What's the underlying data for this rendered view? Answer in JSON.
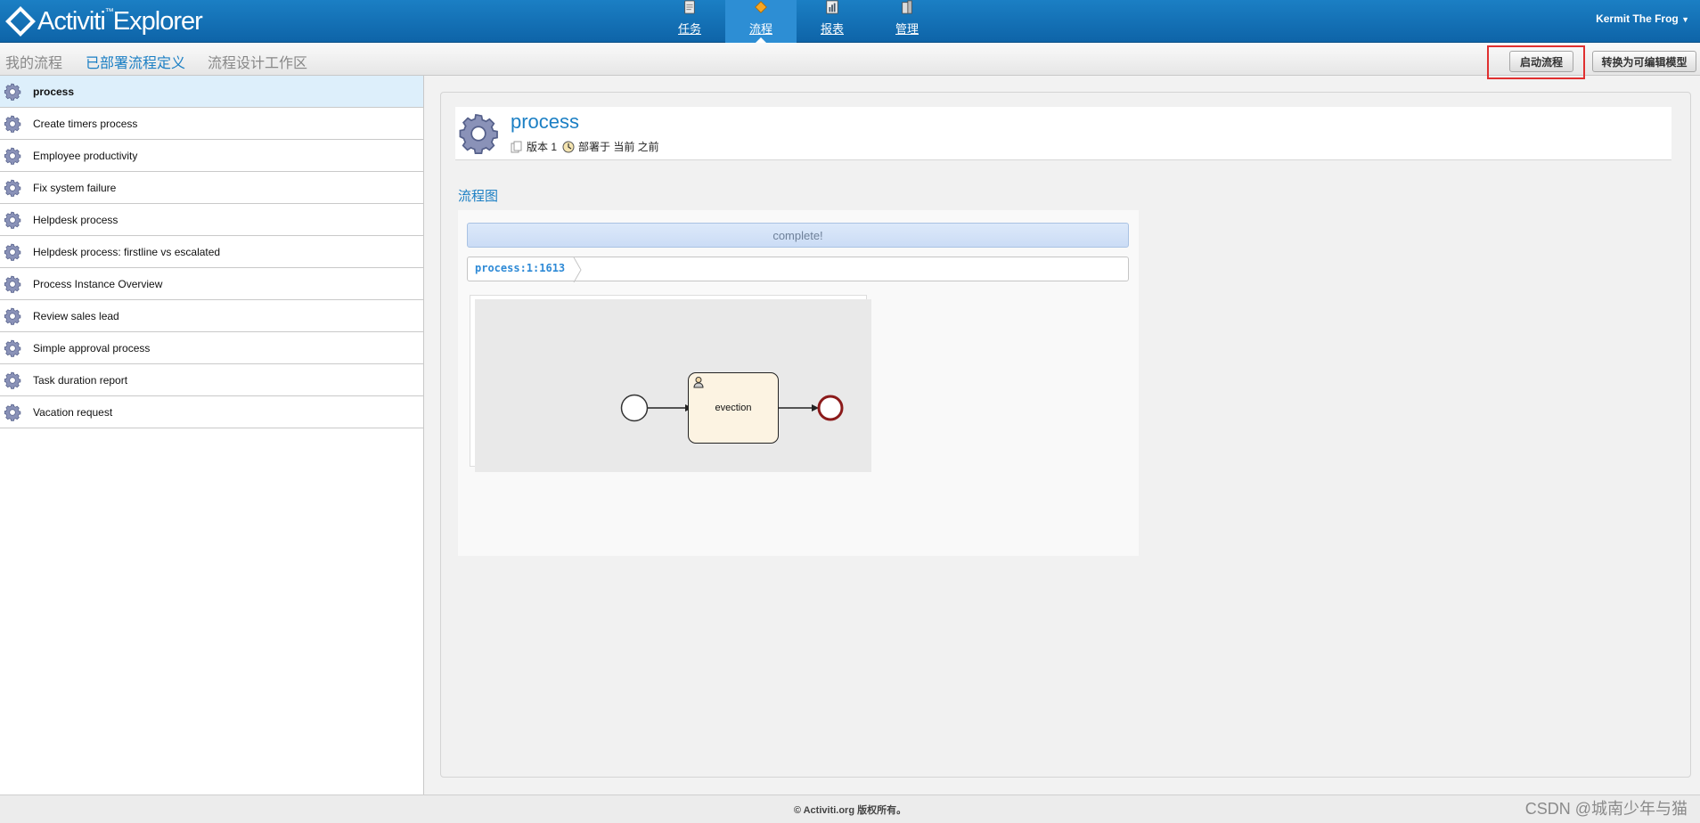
{
  "app": {
    "logo_text": "Activiti",
    "logo_text2": "Explorer",
    "user_name": "Kermit The Frog"
  },
  "nav": {
    "tasks": "任务",
    "process": "流程",
    "reports": "报表",
    "manage": "管理"
  },
  "subnav": {
    "my_process": "我的流程",
    "deployed": "已部署流程定义",
    "workspace": "流程设计工作区"
  },
  "actions": {
    "start_process": "启动流程",
    "convert_model": "转换为可编辑模型"
  },
  "process_list": [
    "process",
    "Create timers process",
    "Employee productivity",
    "Fix system failure",
    "Helpdesk process",
    "Helpdesk process: firstline vs escalated",
    "Process Instance Overview",
    "Review sales lead",
    "Simple approval process",
    "Task duration report",
    "Vacation request"
  ],
  "detail": {
    "title": "process",
    "version": "版本 1",
    "deployed": "部署于 当前 之前",
    "section": "流程图",
    "status": "complete!",
    "breadcrumb": "process:1:1613",
    "task_name": "evection"
  },
  "footer": {
    "copyright": "© Activiti.org 版权所有。"
  },
  "watermark": "CSDN @城南少年与猫",
  "colors": {
    "brand": "#1b7fc4",
    "highlight": "#e03030",
    "end_event": "#8b1a1a"
  }
}
